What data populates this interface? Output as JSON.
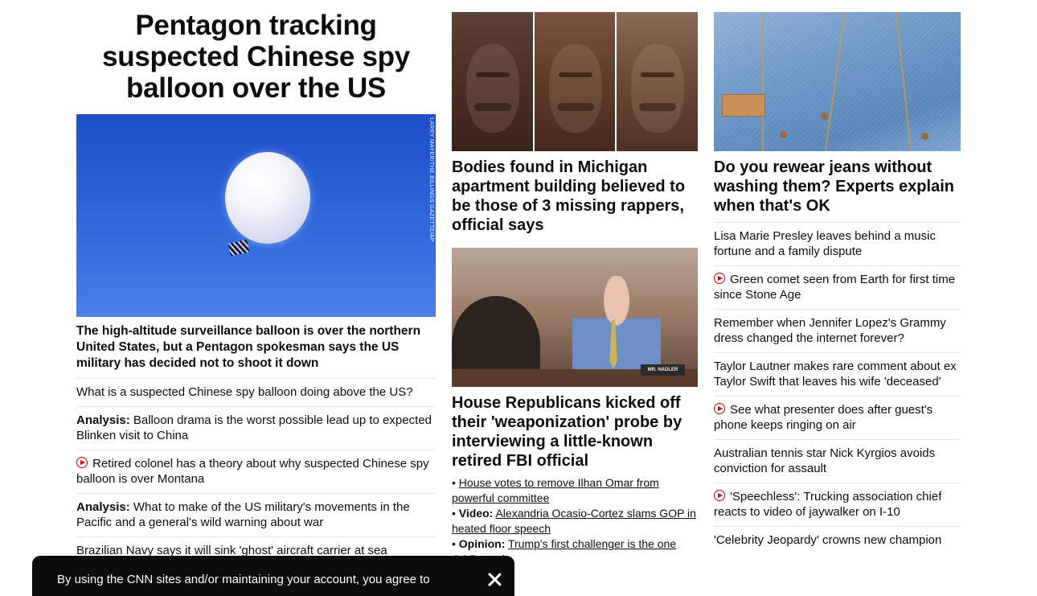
{
  "lead": {
    "headline": "Pentagon tracking suspected Chinese spy balloon over the US",
    "photo_credit": "LARRY MAYER/THE BILLINGS GAZETTE/AP",
    "dek": "The high-altitude surveillance balloon is over the northern United States, but a Pentagon spokesman says the US military has decided not to shoot it down",
    "stories": [
      {
        "kicker": "",
        "text": "What is a suspected Chinese spy balloon doing above the US?",
        "video": false
      },
      {
        "kicker": "Analysis:",
        "text": " Balloon drama is the worst possible lead up to expected Blinken visit to China",
        "video": false
      },
      {
        "kicker": "",
        "text": "Retired colonel has a theory about why suspected Chinese spy balloon is over Montana",
        "video": true
      },
      {
        "kicker": "Analysis:",
        "text": " What to make of the US military's movements in the Pacific and a general's wild warning about war",
        "video": false
      },
      {
        "kicker": "",
        "text": "Brazilian Navy says it will sink 'ghost' aircraft carrier at sea",
        "video": false
      }
    ]
  },
  "middle": {
    "headline_1": "Bodies found in Michigan apartment building believed to be those of 3 missing rappers, official says",
    "nameplate": "MR. NADLER",
    "headline_2": "House Republicans kicked off their 'weaponization' probe by interviewing a little-known retired FBI official",
    "bullets": [
      {
        "kicker": "",
        "text": "House votes to remove Ilhan Omar from powerful committee"
      },
      {
        "kicker": "Video:",
        "text": "Alexandria Ocasio-Cortez slams GOP in heated floor speech"
      },
      {
        "kicker": "Opinion:",
        "text": "Trump's first challenger is the one GOP needs"
      }
    ]
  },
  "right": {
    "headline": "Do you rewear jeans without washing them? Experts explain when that's OK",
    "stories": [
      {
        "text": "Lisa Marie Presley leaves behind a music fortune and a family dispute",
        "video": false
      },
      {
        "text": "Green comet seen from Earth for first time since Stone Age",
        "video": true
      },
      {
        "text": "Remember when Jennifer Lopez's Grammy dress changed the internet forever?",
        "video": false
      },
      {
        "text": "Taylor Lautner makes rare comment about ex Taylor Swift that leaves his wife 'deceased'",
        "video": false
      },
      {
        "text": "See what presenter does after guest's phone keeps ringing on air",
        "video": true
      },
      {
        "text": "Australian tennis star Nick Kyrgios avoids conviction for assault",
        "video": false
      },
      {
        "text": "'Speechless': Trucking association chief reacts to video of jaywalker on I-10",
        "video": true
      },
      {
        "text": "'Celebrity Jeopardy' crowns new champion",
        "video": false
      }
    ]
  },
  "cookie_banner": {
    "text": "By using the CNN sites and/or maintaining your account, you agree to"
  },
  "colors": {
    "video_red": "#cc0000",
    "banner_bg": "#0c0c0c",
    "divider": "#e6e6e6"
  }
}
